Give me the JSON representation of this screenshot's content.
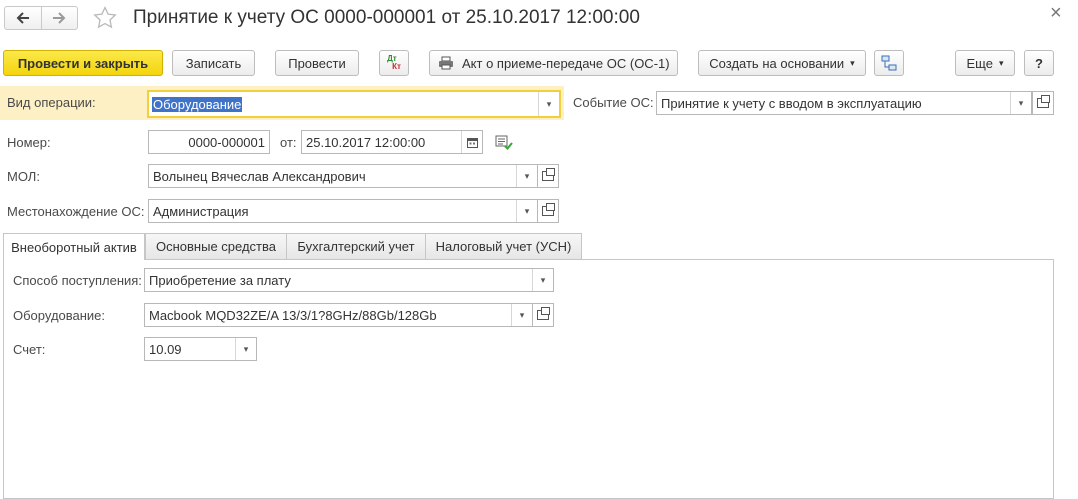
{
  "window": {
    "title": "Принятие к учету ОС 0000-000001 от 25.10.2017 12:00:00",
    "close_glyph": "×"
  },
  "toolbar": {
    "post_close": "Провести и закрыть",
    "save": "Записать",
    "post": "Провести",
    "dtkt_top": "Дт",
    "dtkt_bottom": "Кт",
    "act": "Акт о приеме-передаче ОС (ОС-1)",
    "create_basis": "Создать на основании",
    "more": "Еще",
    "help": "?"
  },
  "header": {
    "operation_label": "Вид операции:",
    "operation_value": "Оборудование",
    "event_label": "Событие ОС:",
    "event_value": "Принятие к учету с вводом в эксплуатацию",
    "number_label": "Номер:",
    "number_value": "0000-000001",
    "date_label": "от:",
    "date_value": "25.10.2017 12:00:00",
    "mol_label": "МОЛ:",
    "mol_value": "Волынец Вячеслав Александрович",
    "location_label": "Местонахождение ОС:",
    "location_value": "Администрация"
  },
  "tabs": [
    {
      "label": "Внеоборотный актив"
    },
    {
      "label": "Основные средства"
    },
    {
      "label": "Бухгалтерский учет"
    },
    {
      "label": "Налоговый учет (УСН)"
    }
  ],
  "asset": {
    "method_label": "Способ поступления:",
    "method_value": "Приобретение за плату",
    "equipment_label": "Оборудование:",
    "equipment_value": "Macbook MQD32ZE/A 13/3/1?8GHz/88Gb/128Gb",
    "account_label": "Счет:",
    "account_value": "10.09"
  },
  "colors": {
    "primary_button": "#f4d40c",
    "highlight_row": "#fdf0c4",
    "focus_border": "#f2cf3b",
    "selection": "#3f73c8"
  }
}
